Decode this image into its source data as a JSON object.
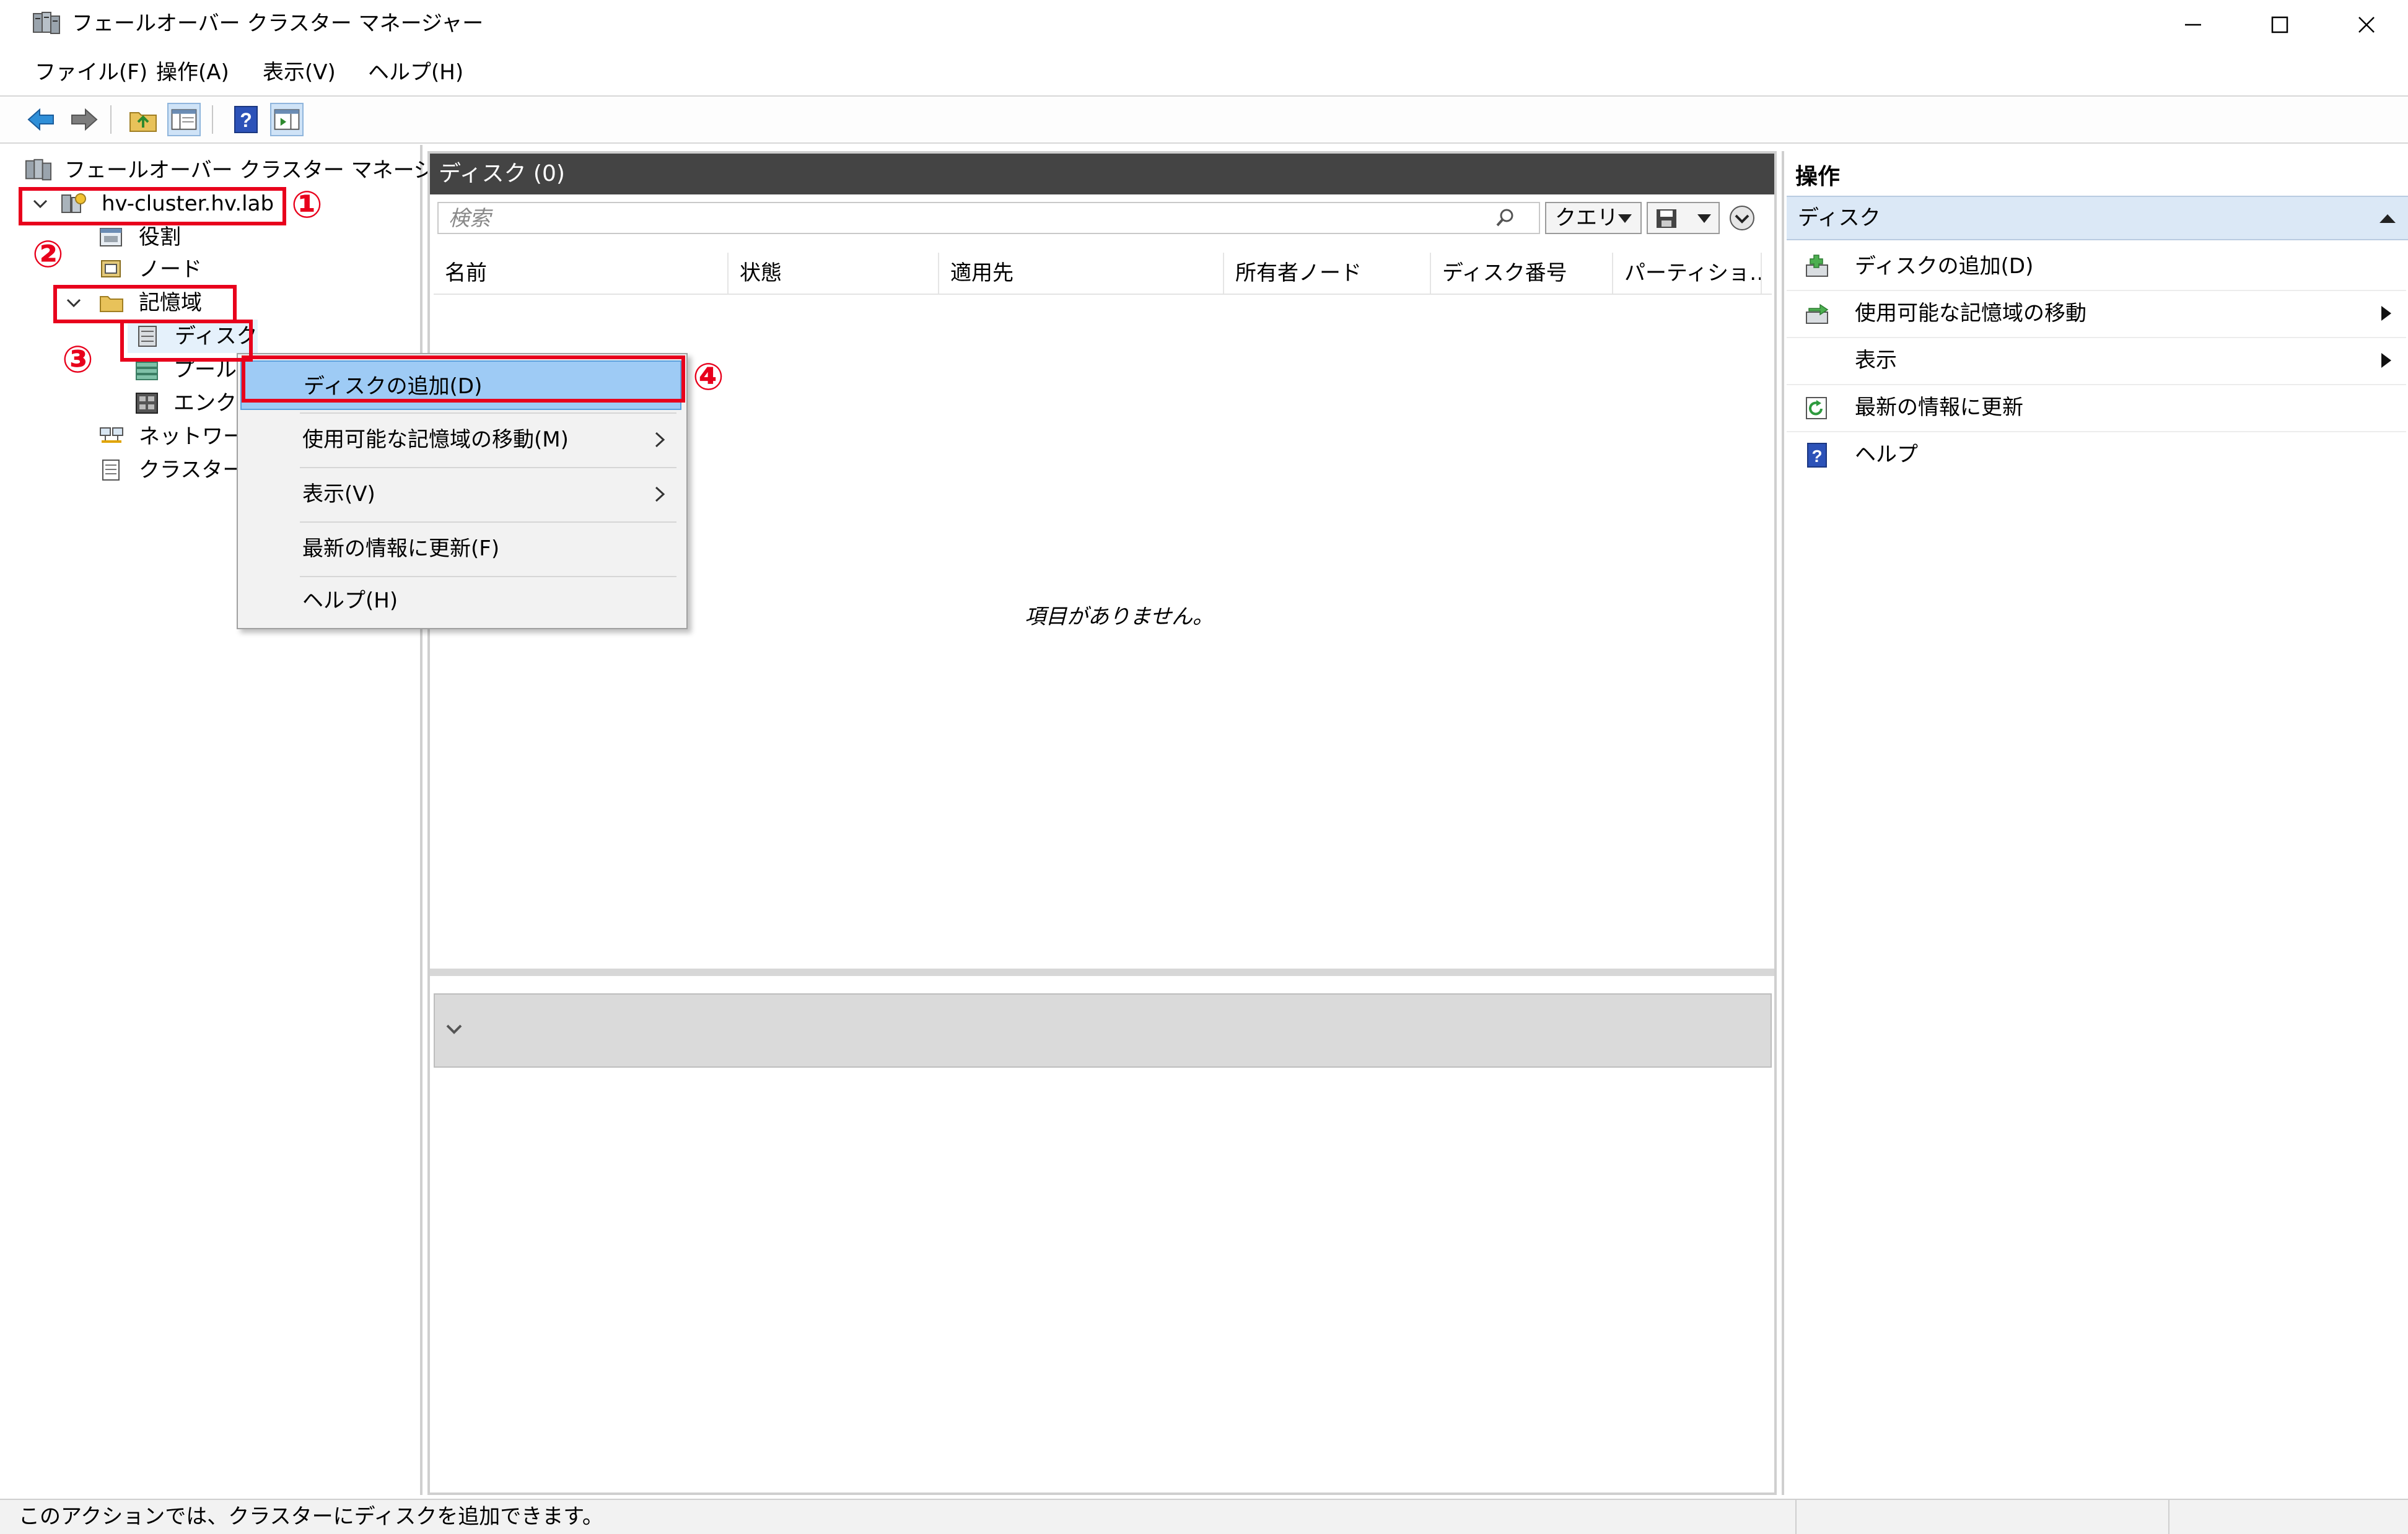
{
  "window": {
    "title": "フェールオーバー クラスター マネージャー"
  },
  "menubar": {
    "items": [
      "ファイル(F)",
      "操作(A)",
      "表示(V)",
      "ヘルプ(H)"
    ]
  },
  "toolbar": {
    "buttons": [
      "back-arrow-icon",
      "forward-arrow-icon",
      "up-folder-icon",
      "show-hide-tree-icon",
      "help-icon",
      "show-hide-action-pane-icon"
    ]
  },
  "tree": {
    "root": "フェールオーバー クラスター マネージャー",
    "cluster": "hv-cluster.hv.lab",
    "roles": "役割",
    "nodes": "ノード",
    "storage": "記憶域",
    "disks": "ディスク",
    "pools": "プール",
    "enclosures": "エンクロ",
    "networks": "ネットワーク",
    "cluster_events": "クラスター イ"
  },
  "center": {
    "header": "ディスク (0)",
    "search_placeholder": "検索",
    "query_button": "クエリ",
    "columns": [
      "名前",
      "状態",
      "適用先",
      "所有者ノード",
      "ディスク番号",
      "パーティショ…"
    ],
    "empty_message": "項目がありません。"
  },
  "actions": {
    "title": "操作",
    "section": "ディスク",
    "items": [
      {
        "label": "ディスクの追加(D)",
        "icon": "add-disk-icon",
        "submenu": false
      },
      {
        "label": "使用可能な記憶域の移動",
        "icon": "move-storage-icon",
        "submenu": true
      },
      {
        "label": "表示",
        "icon": "",
        "submenu": true
      },
      {
        "label": "最新の情報に更新",
        "icon": "refresh-icon",
        "submenu": false
      },
      {
        "label": "ヘルプ",
        "icon": "help-icon",
        "submenu": false
      }
    ]
  },
  "context_menu": {
    "items": [
      {
        "label": "ディスクの追加(D)",
        "submenu": false,
        "highlighted": true
      },
      {
        "label": "使用可能な記憶域の移動(M)",
        "submenu": true,
        "highlighted": false
      },
      {
        "label": "表示(V)",
        "submenu": true,
        "highlighted": false
      },
      {
        "label": "最新の情報に更新(F)",
        "submenu": false,
        "highlighted": false
      },
      {
        "label": "ヘルプ(H)",
        "submenu": false,
        "highlighted": false
      }
    ]
  },
  "annotations": {
    "step1": "①",
    "step2": "②",
    "step3": "③",
    "step4": "④"
  },
  "statusbar": {
    "text": "このアクションでは、クラスターにディスクを追加できます。"
  },
  "colors": {
    "annotation_red": "#e8001c",
    "menu_highlight": "#9ecbf5",
    "action_section_bg": "#dbe8f6",
    "center_header_bg": "#444444"
  }
}
